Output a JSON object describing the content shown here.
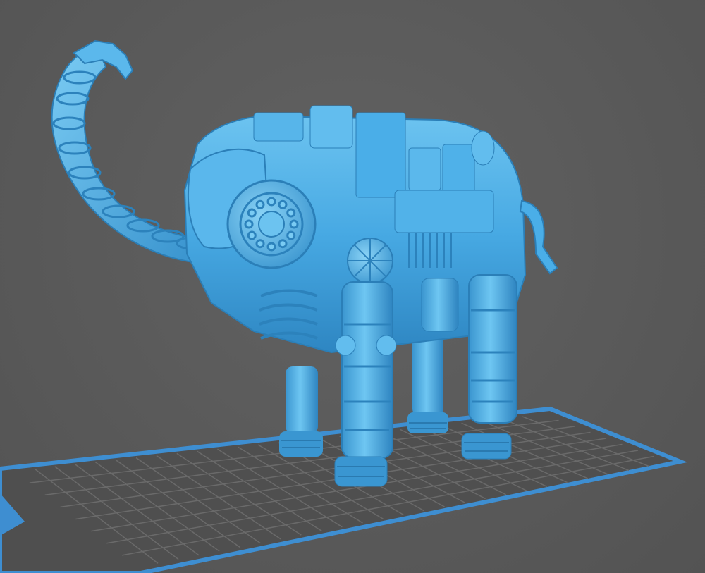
{
  "viewport": {
    "background_color": "#5a5a5a",
    "plate_color": "#4e4e4e",
    "plate_border_color": "#3e8ed1",
    "grid_color": "#6b6b6b",
    "model_color": "#4aaee8",
    "model_shadow_color": "#2b7fb8",
    "model_highlight_color": "#8fd2f5"
  },
  "model": {
    "subject": "mechanical-elephant",
    "icon": "mechanical-elephant-model"
  }
}
